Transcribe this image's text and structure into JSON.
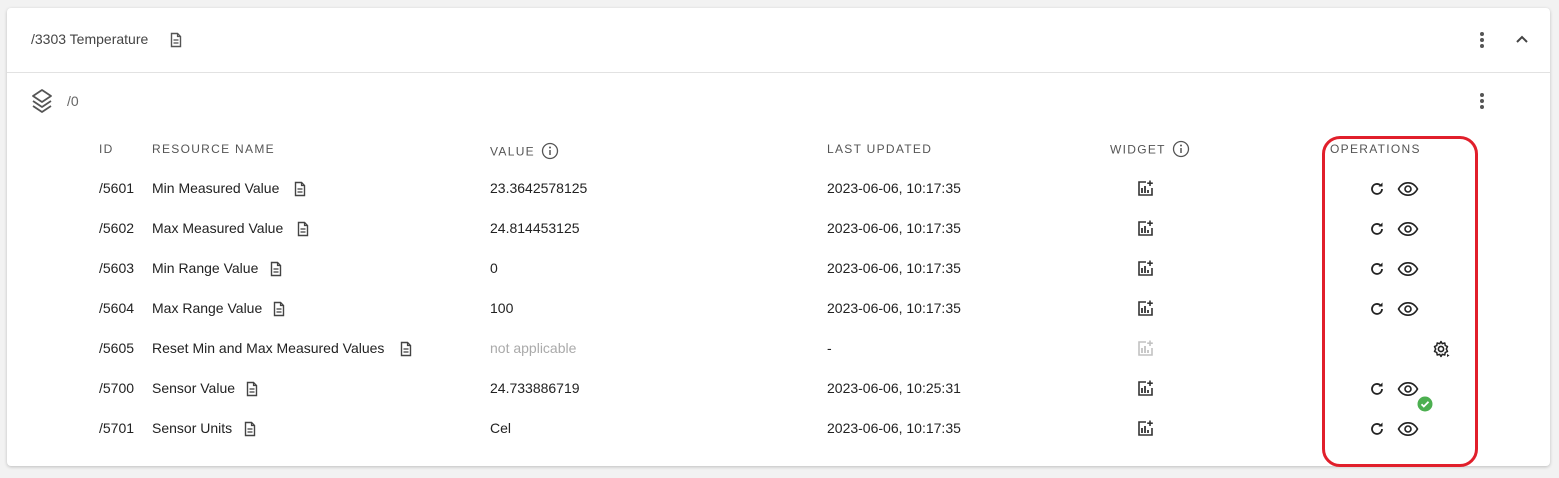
{
  "object": {
    "title": "/3303 Temperature",
    "title_icon": "document-icon",
    "menu_icon": "kebab-menu-icon",
    "collapse_icon": "chevron-up-icon"
  },
  "instance": {
    "label": "/0",
    "icon": "layers-icon",
    "menu_icon": "kebab-menu-icon"
  },
  "table": {
    "headers": {
      "id": "ID",
      "name": "RESOURCE NAME",
      "value": "VALUE",
      "last_updated": "LAST UPDATED",
      "widget": "WIDGET",
      "operations": "OPERATIONS"
    },
    "rows": [
      {
        "id": "/5601",
        "name": "Min Measured Value",
        "value": "23.3642578125",
        "last_updated": "2023-06-06, 10:17:35",
        "operations": [
          "refresh-icon",
          "eye-icon"
        ]
      },
      {
        "id": "/5602",
        "name": "Max Measured Value",
        "value": "24.814453125",
        "last_updated": "2023-06-06, 10:17:35",
        "operations": [
          "refresh-icon",
          "eye-icon"
        ]
      },
      {
        "id": "/5603",
        "name": "Min Range Value",
        "value": "0",
        "last_updated": "2023-06-06, 10:17:35",
        "operations": [
          "refresh-icon",
          "eye-icon"
        ]
      },
      {
        "id": "/5604",
        "name": "Max Range Value",
        "value": "100",
        "last_updated": "2023-06-06, 10:17:35",
        "operations": [
          "refresh-icon",
          "eye-icon"
        ]
      },
      {
        "id": "/5605",
        "name": "Reset Min and Max Measured Values",
        "value": "not applicable",
        "last_updated": "-",
        "operations": [
          "execute-gear-icon"
        ]
      },
      {
        "id": "/5700",
        "name": "Sensor Value",
        "value": "24.733886719",
        "last_updated": "2023-06-06, 10:25:31",
        "operations": [
          "refresh-icon",
          "eye-icon",
          "check-badge-icon"
        ]
      },
      {
        "id": "/5701",
        "name": "Sensor Units",
        "value": "Cel",
        "last_updated": "2023-06-06, 10:17:35",
        "operations": [
          "refresh-icon",
          "eye-icon"
        ]
      }
    ]
  },
  "colors": {
    "highlight": "#e11f2b",
    "success": "#4caf50",
    "text": "#222222",
    "muted": "#aaaaaa"
  }
}
